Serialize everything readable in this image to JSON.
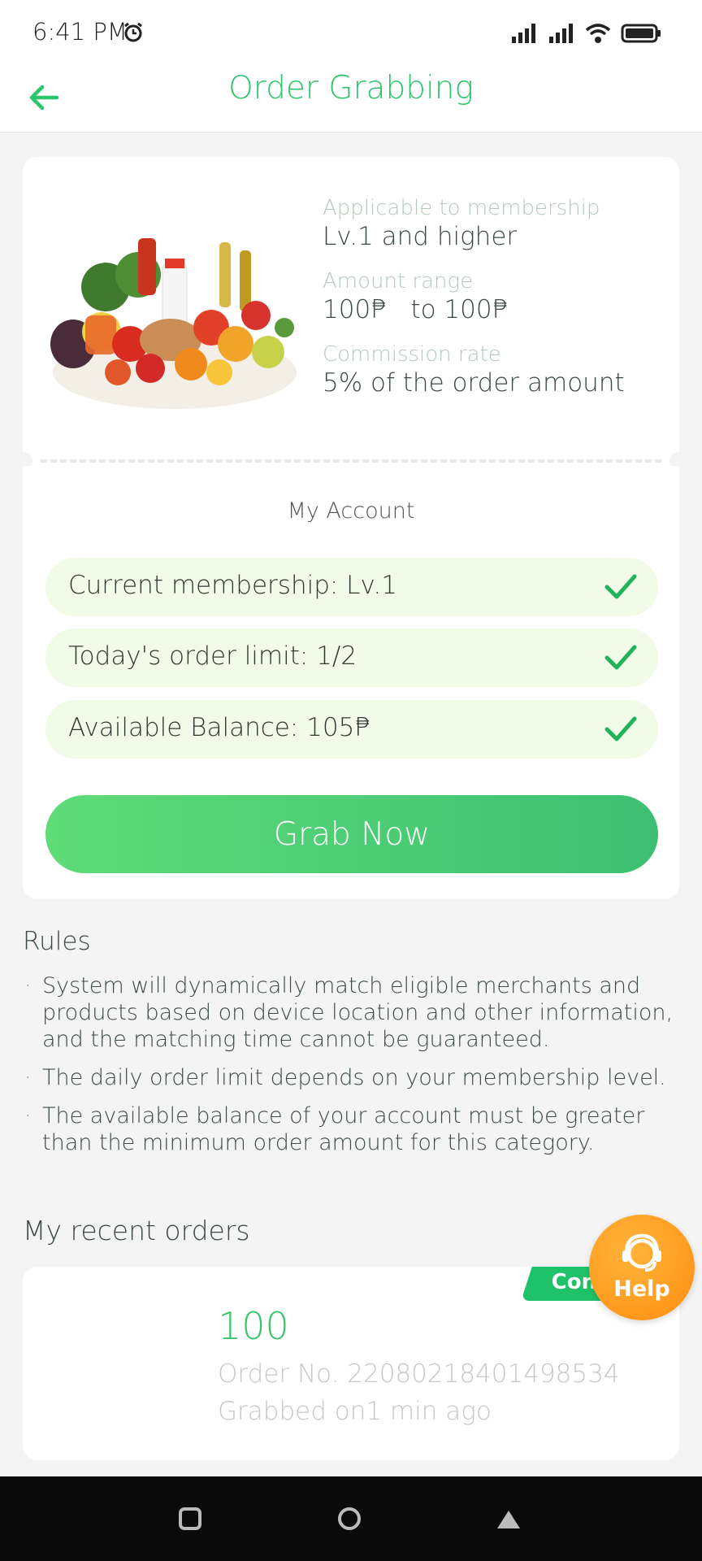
{
  "status_bar": {
    "time": "6:41 PM",
    "icons": [
      "alarm-icon",
      "signal-icon",
      "signal-icon",
      "wifi-icon",
      "battery-icon"
    ]
  },
  "header": {
    "title": "Order Grabbing",
    "back_icon": "arrow-left-icon"
  },
  "product": {
    "membership_label": "Applicable to membership",
    "membership_value": "Lv.1 and higher",
    "amount_label": "Amount range",
    "amount_value": "100₱   to 100₱",
    "commission_label": "Commission rate",
    "commission_value": "5% of the order amount"
  },
  "account": {
    "title": "My Account",
    "rows": [
      {
        "text": "Current membership: Lv.1"
      },
      {
        "text": "Today's order limit: 1/2"
      },
      {
        "text": "Available Balance: 105₱"
      }
    ],
    "grab_label": "Grab Now"
  },
  "rules": {
    "title": "Rules",
    "items": [
      "System will dynamically match eligible merchants and products based on device location and other information, and the matching time cannot be guaranteed.",
      "The daily order limit depends on your membership level.",
      "The available balance of your account must be greater than the minimum order amount for this category."
    ]
  },
  "recent_orders": {
    "title": "My recent orders",
    "orders": [
      {
        "status": "Con",
        "amount": "100",
        "order_no": "Order No. 22080218401498534",
        "grabbed": "Grabbed on1 min ago"
      }
    ]
  },
  "help": {
    "label": "Help"
  },
  "colors": {
    "accent": "#2ec56c",
    "row_bg": "#f1fbe8",
    "help": "#ff9a1f"
  }
}
